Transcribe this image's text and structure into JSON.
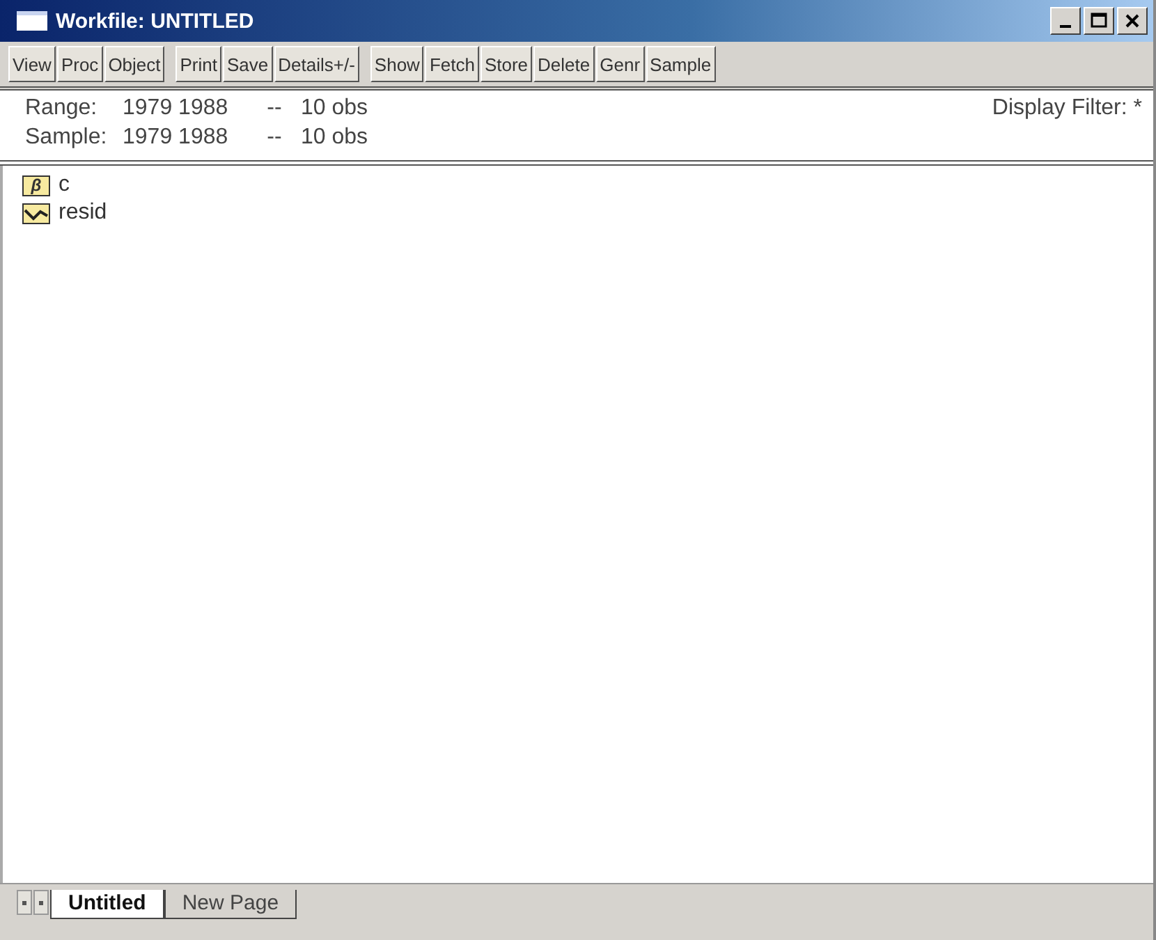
{
  "window": {
    "title": "Workfile: UNTITLED"
  },
  "toolbar": [
    [
      "View",
      "Proc",
      "Object"
    ],
    [
      "Print",
      "Save",
      "Details+/-"
    ],
    [
      "Show",
      "Fetch",
      "Store",
      "Delete",
      "Genr",
      "Sample"
    ]
  ],
  "info": {
    "range": {
      "label": "Range:",
      "value": "1979 1988",
      "sep": "--",
      "obs": "10 obs"
    },
    "sample": {
      "label": "Sample:",
      "value": "1979 1988",
      "sep": "--",
      "obs": "10 obs"
    },
    "filter": "Display Filter: *"
  },
  "objects": [
    {
      "kind": "coef",
      "glyph": "β",
      "name": "c"
    },
    {
      "kind": "series",
      "name": "resid"
    }
  ],
  "tabs": [
    {
      "label": "Untitled",
      "selected": true
    },
    {
      "label": "New Page",
      "selected": false
    }
  ]
}
